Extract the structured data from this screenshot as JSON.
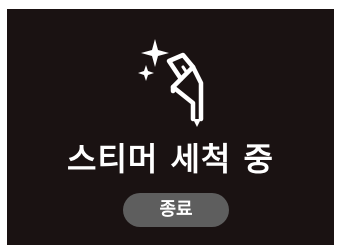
{
  "status": {
    "icon": "steam-cleaning-icon",
    "title": "스티머 세척 중"
  },
  "actions": {
    "stop_label": "종료"
  },
  "colors": {
    "background": "#1a1212",
    "text": "#ffffff",
    "button": "#5e5e5e"
  }
}
